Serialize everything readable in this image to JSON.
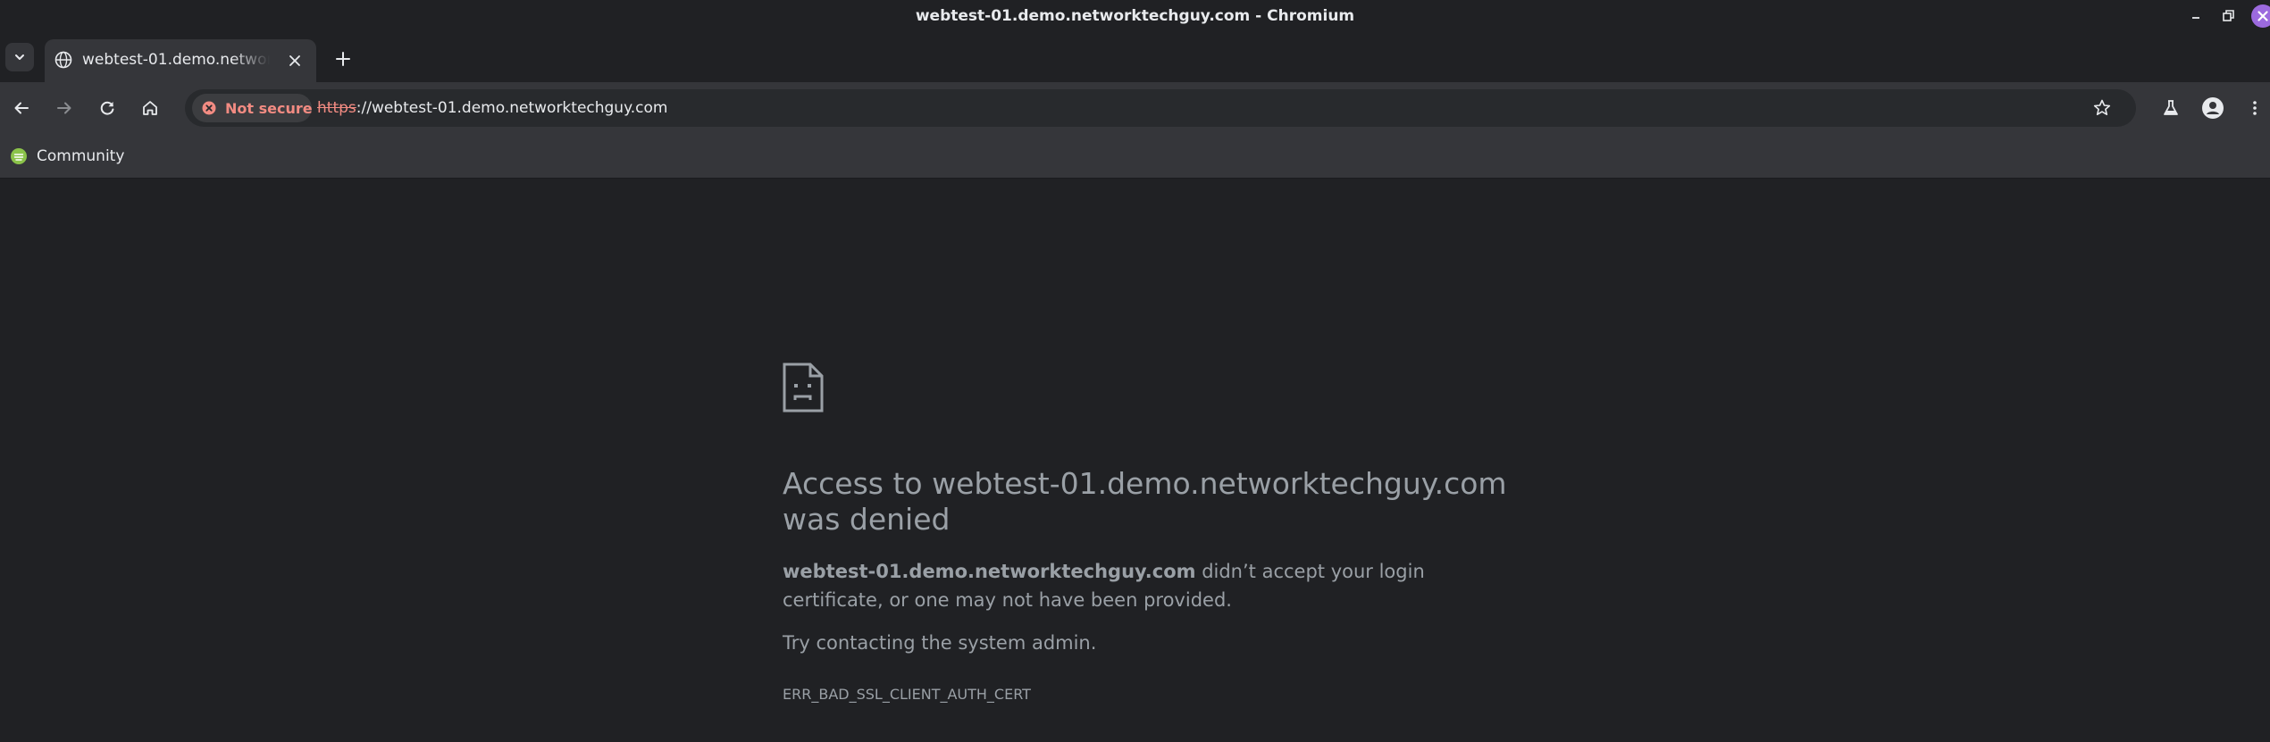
{
  "window": {
    "title": "webtest-01.demo.networktechguy.com - Chromium",
    "controls": [
      "minimize-icon",
      "restore-icon",
      "close-icon"
    ]
  },
  "tabs": [
    {
      "title": "webtest-01.demo.networktechguy.com",
      "icon": "globe-icon",
      "active": true
    }
  ],
  "toolbar": {
    "buttons": [
      "back-icon",
      "forward-icon",
      "reload-icon",
      "home-icon"
    ],
    "security_chip": "Not secure",
    "url_scheme": "https",
    "url_rest": "://webtest-01.demo.networktechguy.com",
    "right_icons": [
      "star-icon",
      "flask-icon",
      "profile-icon",
      "menu-icon"
    ]
  },
  "bookmarks": [
    {
      "label": "Community",
      "icon": "community-icon"
    }
  ],
  "error_page": {
    "heading": "Access to webtest-01.demo.networktechguy.com was denied",
    "host": "webtest-01.demo.networktechguy.com",
    "description_rest": " didn’t accept your login certificate, or one may not have been provided.",
    "help": "Try contacting the system admin.",
    "code": "ERR_BAD_SSL_CLIENT_AUTH_CERT"
  },
  "colors": {
    "frame": "#202124",
    "toolbar": "#35363a",
    "omnibox": "#282a2d",
    "warning": "#f28b82",
    "close_button": "#9c6ade",
    "text_muted": "#9aa0a6"
  }
}
